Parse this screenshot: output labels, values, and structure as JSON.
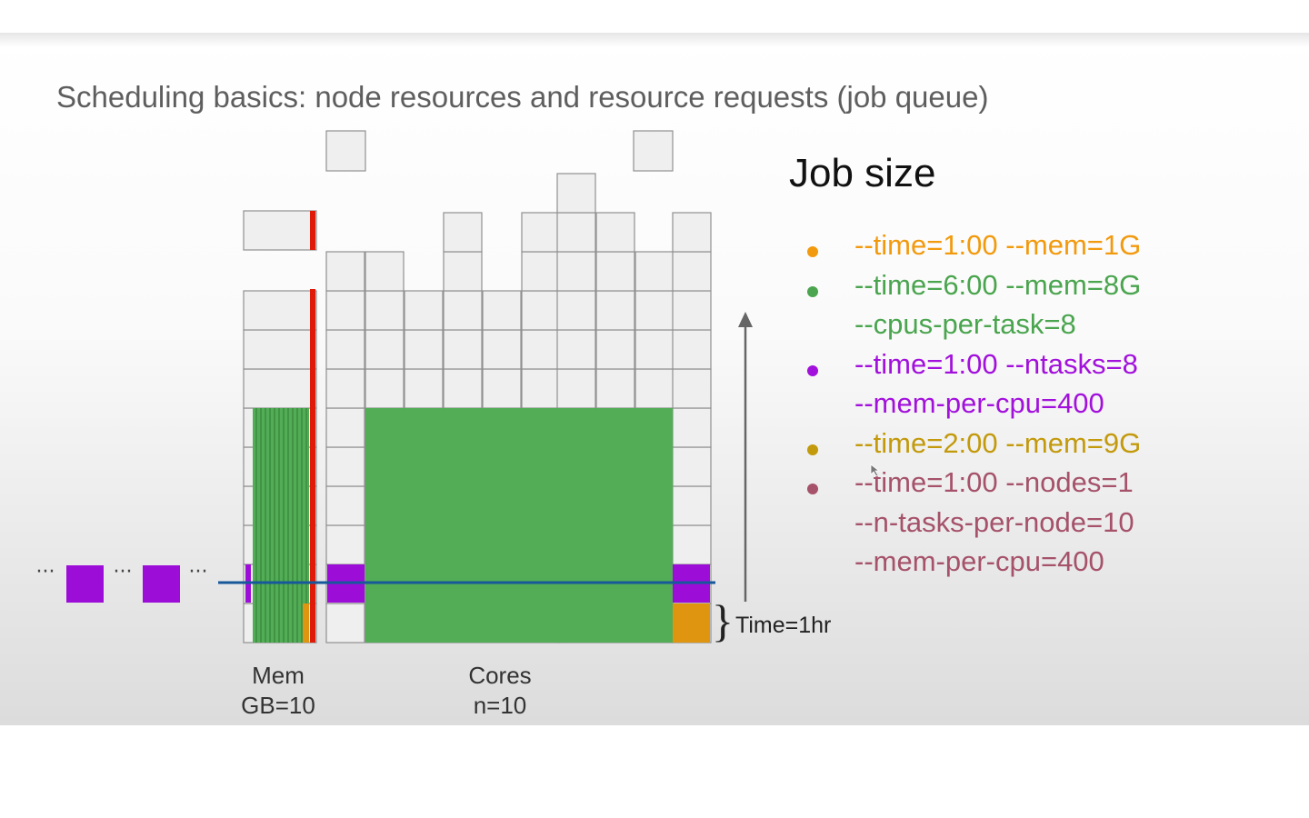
{
  "slide": {
    "title": "Scheduling basics: node resources and resource requests (job queue)"
  },
  "diagram": {
    "mem_label": [
      "Mem",
      "GB=10"
    ],
    "cores_label": [
      "Cores",
      "n=10"
    ],
    "time_label": "Time=1hr",
    "queue_ellipsis": "···",
    "colors": {
      "grid_fill": "#efefef",
      "grid_line": "#909090",
      "green": "#52ad56",
      "red": "#e01a08",
      "purple": "#9c0ed8",
      "orange": "#e09510",
      "blue_line": "#17589a",
      "arrow": "#666666"
    }
  },
  "legend": {
    "title": "Job size",
    "entries": [
      {
        "color": "#f29a0e",
        "lines": [
          "--time=1:00 --mem=1G"
        ]
      },
      {
        "color": "#4aa54e",
        "lines": [
          "--time=6:00 --mem=8G",
          "--cpus-per-task=8"
        ]
      },
      {
        "color": "#a210dc",
        "lines": [
          "--time=1:00 --ntasks=8",
          "--mem-per-cpu=400"
        ]
      },
      {
        "color": "#c39a0c",
        "lines": [
          "--time=2:00 --mem=9G"
        ]
      },
      {
        "color": "#a5526a",
        "lines": [
          "--time=1:00 --nodes=1",
          "--n-tasks-per-node=10",
          "--mem-per-cpu=400"
        ]
      }
    ]
  }
}
